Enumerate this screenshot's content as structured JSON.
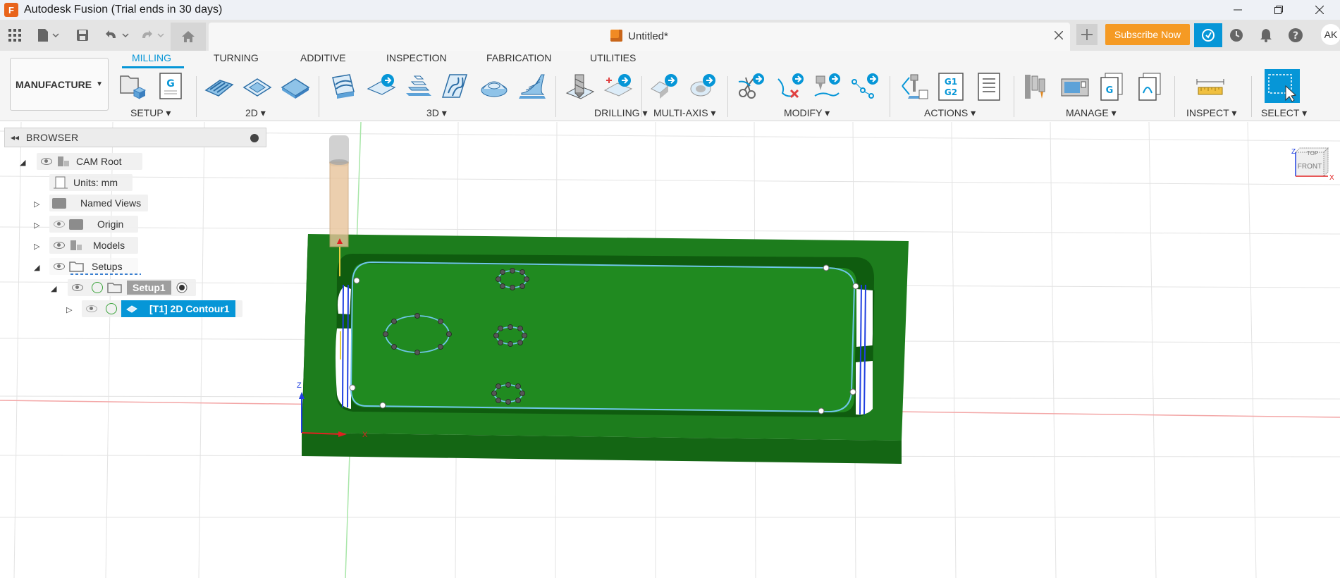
{
  "titlebar": {
    "title": "Autodesk Fusion (Trial ends in 30 days)",
    "logo_letter": "F"
  },
  "document_tab": {
    "title": "Untitled*"
  },
  "quickbar": {
    "subscribe_label": "Subscribe Now",
    "avatar_initials": "AK"
  },
  "ribbon": {
    "workspace": "MANUFACTURE",
    "tabs": [
      {
        "label": "MILLING"
      },
      {
        "label": "TURNING"
      },
      {
        "label": "ADDITIVE"
      },
      {
        "label": "INSPECTION"
      },
      {
        "label": "FABRICATION"
      },
      {
        "label": "UTILITIES"
      }
    ],
    "groups": [
      {
        "label": "SETUP ▾"
      },
      {
        "label": "2D ▾"
      },
      {
        "label": "3D ▾"
      },
      {
        "label": "DRILLING ▾"
      },
      {
        "label": "MULTI-AXIS ▾"
      },
      {
        "label": "MODIFY ▾"
      },
      {
        "label": "ACTIONS ▾"
      },
      {
        "label": "MANAGE ▾"
      },
      {
        "label": "INSPECT ▾"
      },
      {
        "label": "SELECT ▾"
      }
    ],
    "gcode_label_1": "G1",
    "gcode_label_2": "G2",
    "g_label": "G"
  },
  "browser": {
    "title": "BROWSER",
    "items": [
      {
        "label": "CAM Root"
      },
      {
        "label": "Units: mm"
      },
      {
        "label": "Named Views"
      },
      {
        "label": "Origin"
      },
      {
        "label": "Models"
      },
      {
        "label": "Setups"
      },
      {
        "label": "Setup1"
      },
      {
        "label": "[T1] 2D Contour1"
      }
    ]
  },
  "viewcube": {
    "top_label": "TOP",
    "front_label": "FRONT",
    "z_label": "Z",
    "x_label": "X"
  },
  "axis_triad": {
    "z_label": "Z",
    "x_label": "X"
  },
  "colors": {
    "accent": "#0696d7",
    "stock_green": "#1a7a1a",
    "subscribe": "#f59a23"
  }
}
